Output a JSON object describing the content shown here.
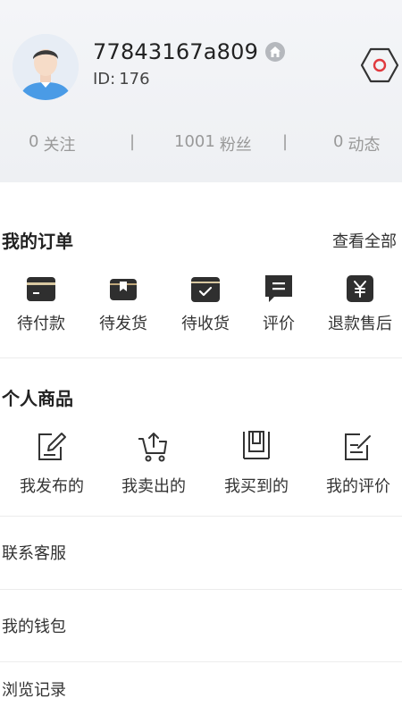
{
  "profile": {
    "username": "77843167a809",
    "id_label": "ID:",
    "id_value": "176"
  },
  "stats": {
    "following_count": "0",
    "following_label": "关注",
    "fans_count": "1001",
    "fans_label": "粉丝",
    "posts_count": "0",
    "posts_label": "动态",
    "separator": "|"
  },
  "orders": {
    "title": "我的订单",
    "view_all": "查看全部",
    "items": [
      {
        "label": "待付款",
        "icon": "wallet-icon"
      },
      {
        "label": "待发货",
        "icon": "package-icon"
      },
      {
        "label": "待收货",
        "icon": "received-box-icon"
      },
      {
        "label": "评价",
        "icon": "review-chat-icon"
      },
      {
        "label": "退款售后",
        "icon": "refund-yen-icon"
      }
    ]
  },
  "products": {
    "title": "个人商品",
    "items": [
      {
        "label": "我发布的",
        "icon": "edit-document-icon"
      },
      {
        "label": "我卖出的",
        "icon": "cart-upload-icon"
      },
      {
        "label": "我买到的",
        "icon": "bag-icon"
      },
      {
        "label": "我的评价",
        "icon": "note-edit-icon"
      }
    ]
  },
  "menu": [
    {
      "label": "联系客服"
    },
    {
      "label": "我的钱包"
    },
    {
      "label": "浏览记录"
    }
  ],
  "colors": {
    "header_bg": "#eef0f3",
    "accent_red": "#e0393e",
    "icon_dark": "#2f2f2f",
    "text_muted": "#999999"
  }
}
